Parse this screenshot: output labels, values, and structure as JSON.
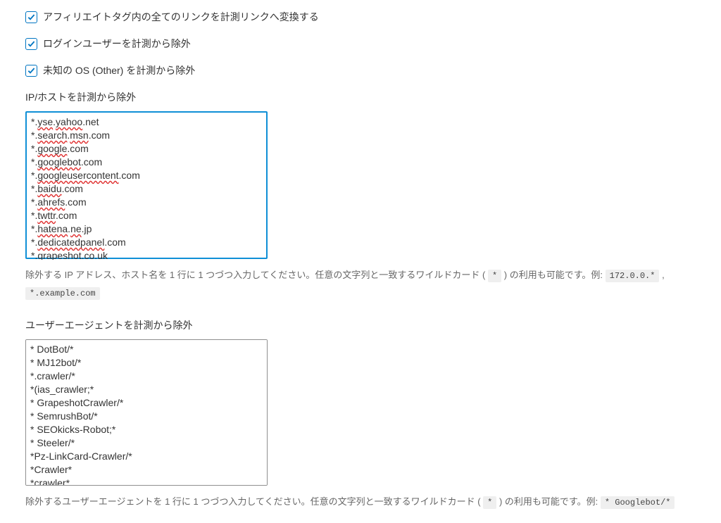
{
  "checkboxes": {
    "affiliate": {
      "checked": true,
      "label": "アフィリエイトタグ内の全てのリンクを計測リンクへ変換する"
    },
    "loggedin": {
      "checked": true,
      "label": "ログインユーザーを計測から除外"
    },
    "unknown_os": {
      "checked": true,
      "label": "未知の OS (Other) を計測から除外"
    }
  },
  "ip_host": {
    "label": "IP/ホストを計測から除外",
    "lines": [
      {
        "pre": "*.",
        "u": "yse",
        "mid": ".",
        "u2": "yahoo",
        "post": ".net"
      },
      {
        "pre": "*.",
        "u": "search",
        "mid": ".",
        "u2": "msn",
        "post": ".com"
      },
      {
        "pre": "*.",
        "u": "google",
        "mid": "",
        "u2": "",
        "post": ".com"
      },
      {
        "pre": "*.",
        "u": "googlebot",
        "mid": "",
        "u2": "",
        "post": ".com"
      },
      {
        "pre": "*.",
        "u": "googleusercontent",
        "mid": "",
        "u2": "",
        "post": ".com"
      },
      {
        "pre": "*.",
        "u": "baidu",
        "mid": "",
        "u2": "",
        "post": ".com"
      },
      {
        "pre": "*.",
        "u": "ahrefs",
        "mid": "",
        "u2": "",
        "post": ".com"
      },
      {
        "pre": "*.",
        "u": "twttr",
        "mid": "",
        "u2": "",
        "post": ".com"
      },
      {
        "pre": "*.",
        "u": "hatena",
        "mid": ".",
        "u2": "ne",
        "post": ".jp"
      },
      {
        "pre": "*.",
        "u": "dedicatedpanel",
        "mid": "",
        "u2": "",
        "post": ".com"
      },
      {
        "pre": "*.",
        "u": "grapeshot",
        "mid": "",
        "u2": "",
        "post": ".co.uk"
      }
    ],
    "help_pre": "除外する IP アドレス、ホスト名を 1 行に 1 つづつ入力してください。任意の文字列と一致するワイルドカード ( ",
    "help_wild": "*",
    "help_mid": " ) の利用も可能です。例: ",
    "help_ex1": "172.0.0.*",
    "help_sep": " , ",
    "help_ex2": "*.example.com"
  },
  "ua": {
    "label": "ユーザーエージェントを計測から除外",
    "value": "* DotBot/*\n* MJ12bot/*\n*.crawler/*\n*(ias_crawler;*\n* GrapeshotCrawler/*\n* SemrushBot/*\n* SEOkicks-Robot;*\n* Steeler/*\n*Pz-LinkCard-Crawler/*\n*Crawler*\n*crawler*",
    "help_pre": "除外するユーザーエージェントを 1 行に 1 つづつ入力してください。任意の文字列と一致するワイルドカード ( ",
    "help_wild": "*",
    "help_mid": " ) の利用も可能です。例: ",
    "help_ex1": "* Googlebot/*"
  }
}
